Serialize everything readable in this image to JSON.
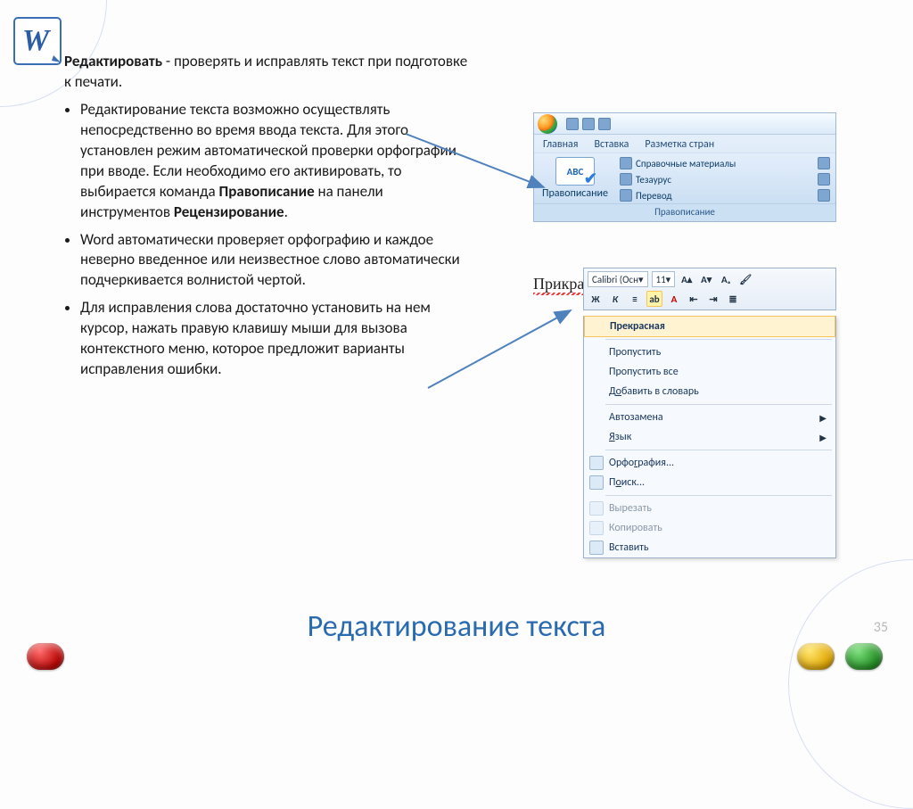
{
  "lead_bold": "Редактировать",
  "lead_rest": " - проверять и исправлять текст при подготовке к печати.",
  "bullets": [
    {
      "pre": "Редактирование текста возможно  осуществлять непосредственно во время ввода текста. Для этого установлен режим автоматической проверки орфографии при вводе. Если необходимо его активировать, то выбирается команда ",
      "b1": "Правописание",
      "mid": " на панели инструментов ",
      "b2": "Рецензирование",
      "post": "."
    },
    {
      "pre": "Word автоматически проверяет орфографию и каждое неверно введенное или неизвестное слово автоматически подчеркивается волнистой чертой.",
      "b1": "",
      "mid": "",
      "b2": "",
      "post": ""
    },
    {
      "pre": "Для исправления слова достаточно установить на нем курсор, нажать правую клавишу мыши для вызова контекстного меню, которое предложит варианты исправления ошибки.",
      "b1": "",
      "mid": "",
      "b2": "",
      "post": ""
    }
  ],
  "ribbon": {
    "tabs": [
      "Главная",
      "Вставка",
      "Разметка стран"
    ],
    "big_btn_abc": "ABC",
    "big_btn_label": "Правописание",
    "items": [
      "Справочные материалы",
      "Тезаурус",
      "Перевод"
    ],
    "group_caption": "Правописание"
  },
  "doc": {
    "mistyped": "Прикрасная",
    "font_name": "Calibri (Осн",
    "font_size": "11"
  },
  "context_menu": {
    "suggestion": "Прекрасная",
    "skip": "Пропустить",
    "skip_all": "Пропустить все",
    "add_dict_pre": "Д",
    "add_dict_ul": "о",
    "add_dict_post": "бавить в словарь",
    "autocorrect": "Автозамена",
    "lang_pre": "",
    "lang_ul": "Я",
    "lang_post": "зык",
    "spelling_pre": "Орфо",
    "spelling_ul": "г",
    "spelling_post": "рафия...",
    "find_pre": "П",
    "find_ul": "о",
    "find_post": "иск...",
    "cut": "Вырезать",
    "copy": "Копировать",
    "paste": "Вставить"
  },
  "slide_title": "Редактирование текста",
  "page_num": "35",
  "mt": {
    "bold": "Ж",
    "italic": "К",
    "A": "A"
  }
}
